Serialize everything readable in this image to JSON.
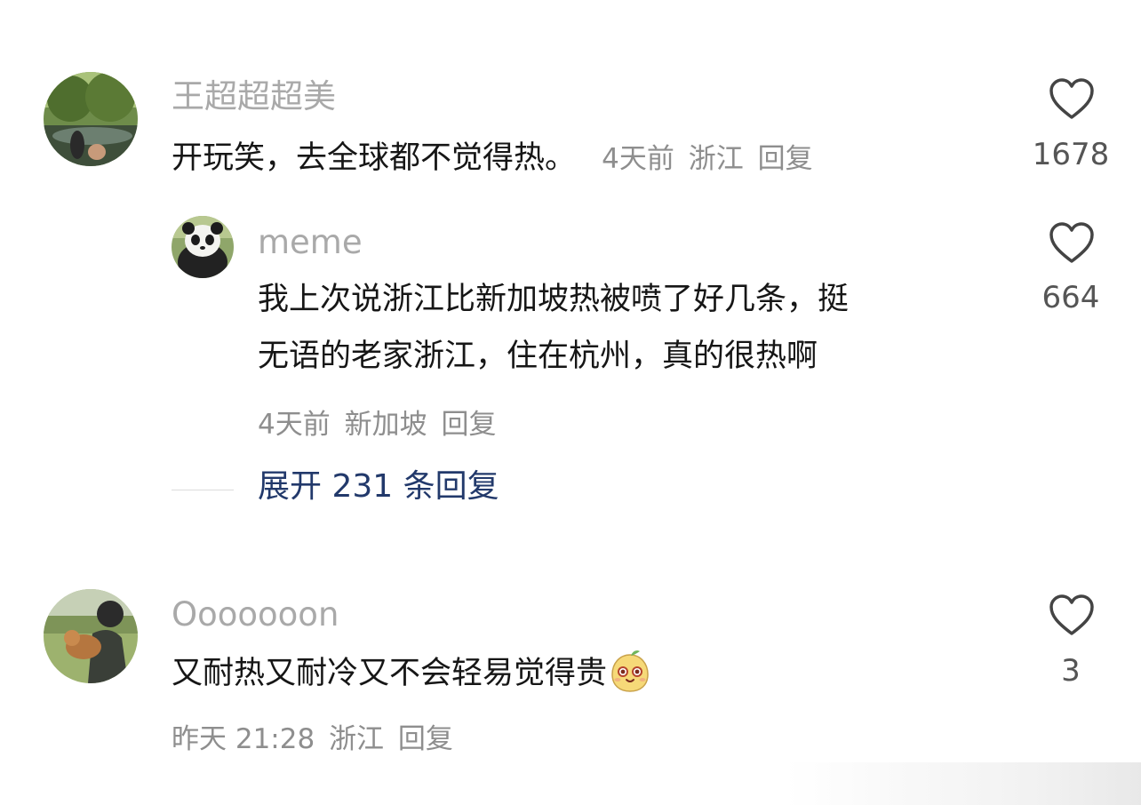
{
  "comments": [
    {
      "username": "王超超超美",
      "text": "开玩笑，去全球都不觉得热。",
      "time": "4天前",
      "location": "浙江",
      "reply_label": "回复",
      "likes": "1678",
      "avatar": "landscape-photo"
    },
    {
      "username": "meme",
      "text_line1": "我上次说浙江比新加坡热被喷了好几条，挺",
      "text_line2": "无语的老家浙江，住在杭州，真的很热啊",
      "time": "4天前",
      "location": "新加坡",
      "reply_label": "回复",
      "likes": "664",
      "avatar": "panda-photo"
    },
    {
      "username": "Ooooooon",
      "text": "又耐热又耐冷又不会轻易觉得贵",
      "time": "昨天 21:28",
      "location": "浙江",
      "reply_label": "回复",
      "likes": "3",
      "avatar": "person-with-dog-photo",
      "emoji": "smiling-pear-emoji"
    }
  ],
  "expand": {
    "label": "展开 231 条回复"
  },
  "colors": {
    "username": "#a9a9a9",
    "text": "#161616",
    "meta": "#8e8e8e",
    "expand": "#22396b",
    "like_count": "#555555"
  }
}
